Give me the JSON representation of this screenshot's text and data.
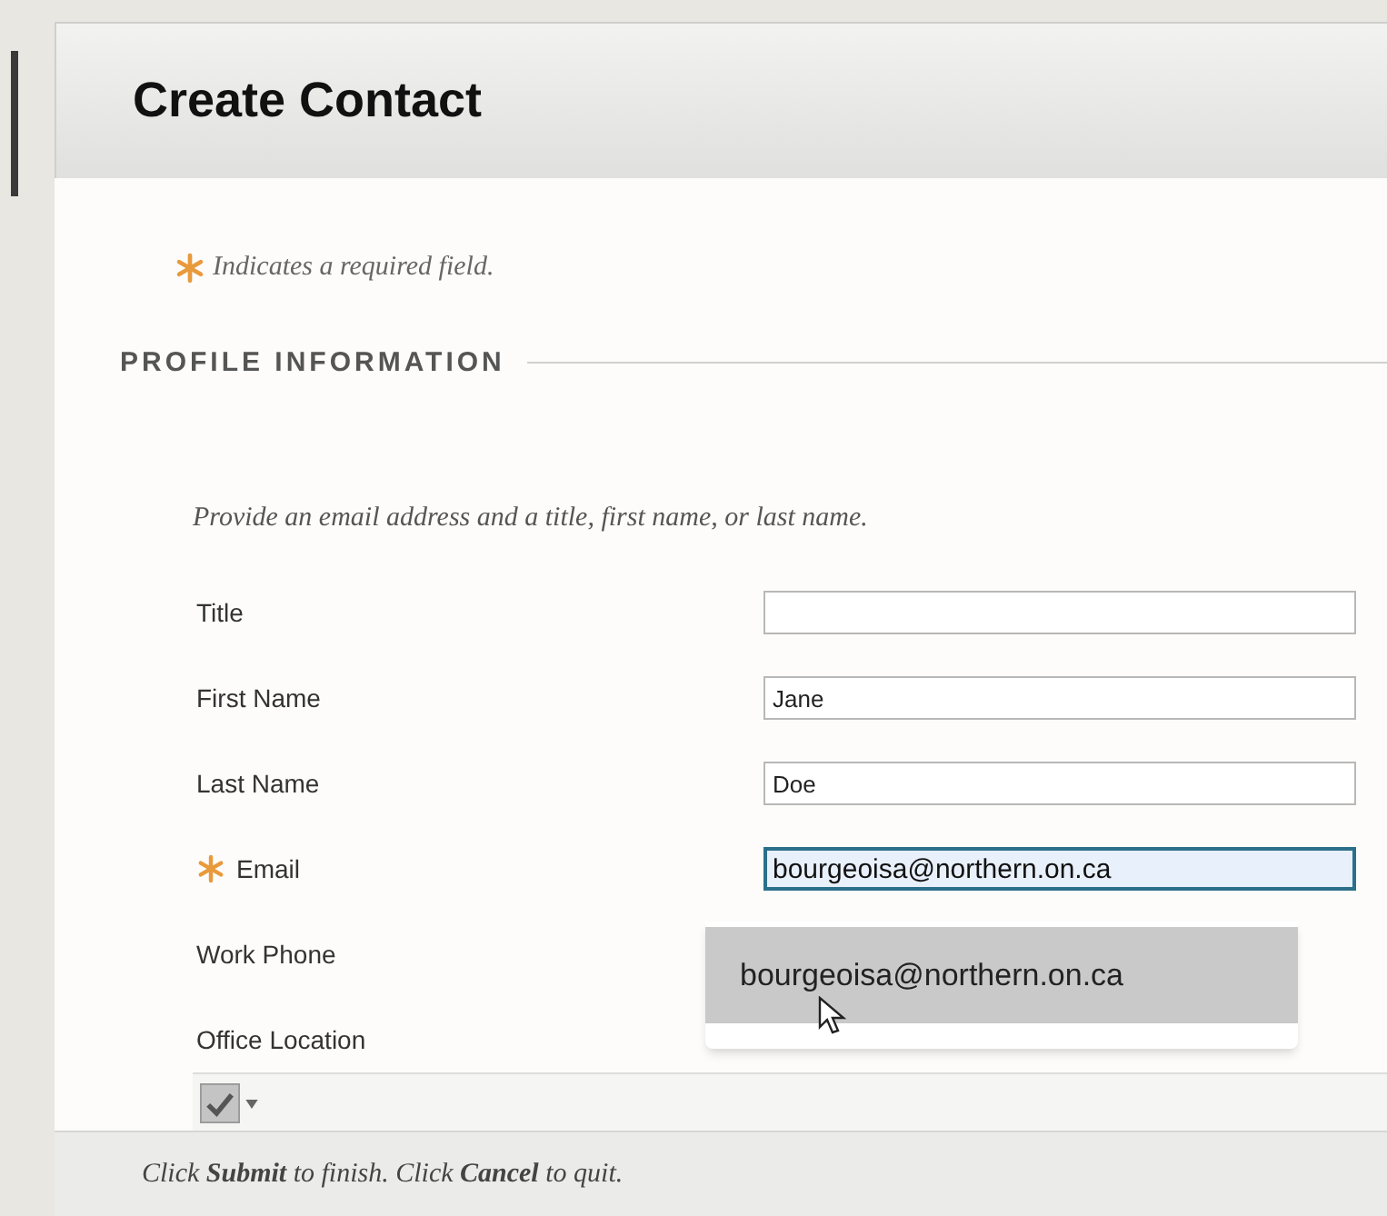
{
  "page": {
    "title": "Create Contact"
  },
  "required_note": "Indicates a required field.",
  "section": {
    "title": "PROFILE INFORMATION"
  },
  "instructions": "Provide an email address and a title, first name, or last name.",
  "fields": [
    {
      "kind": "input",
      "label": "Title",
      "required": false,
      "focused": false
    },
    {
      "kind": "input",
      "label": "First Name",
      "value": "Jane",
      "required": false,
      "focused": false
    },
    {
      "kind": "input",
      "label": "Last Name",
      "value": "Doe",
      "required": false,
      "focused": false
    },
    {
      "kind": "input",
      "label": "Email",
      "value": "bourgeoisa@northern.on.ca",
      "required": true,
      "focused": true
    },
    {
      "kind": "label",
      "label": "Work Phone",
      "required": false
    },
    {
      "kind": "label",
      "label": "Office Location",
      "required": false
    }
  ],
  "autocomplete": {
    "items": [
      {
        "text": "bourgeoisa@northern.on.ca",
        "selected": true
      }
    ]
  },
  "footer": "Click **Submit** to finish. Click **Cancel** to quit."
}
